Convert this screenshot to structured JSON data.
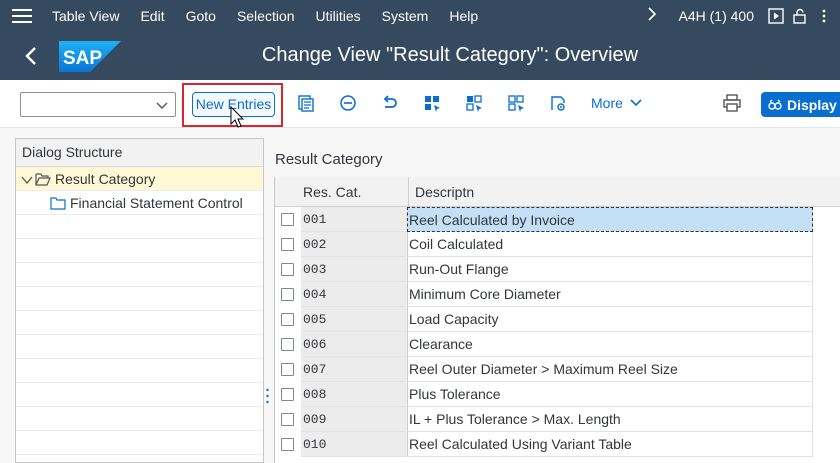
{
  "menubar": {
    "items": [
      "Table View",
      "Edit",
      "Goto",
      "Selection",
      "Utilities",
      "System",
      "Help"
    ],
    "system_info": "A4H (1) 400"
  },
  "titlebar": {
    "logo_text": "SAP",
    "title": "Change View \"Result Category\": Overview"
  },
  "toolbar": {
    "combo_value": "",
    "new_entries_label": "New Entries",
    "more_label": "More",
    "display_label": "Display",
    "icons": [
      "copy-as-icon",
      "delete-icon",
      "undo-icon",
      "select-all-icon",
      "select-block-icon",
      "deselect-all-icon",
      "configuration-icon",
      "print-icon",
      "display-icon"
    ]
  },
  "dialog_structure": {
    "header": "Dialog Structure",
    "items": [
      {
        "label": "Result Category",
        "selected": true,
        "expanded": true
      },
      {
        "label": "Financial Statement Control",
        "selected": false
      }
    ]
  },
  "table": {
    "title": "Result Category",
    "columns": [
      "Res. Cat.",
      "Descriptn"
    ],
    "rows": [
      {
        "key": "001",
        "desc": "Reel Calculated by Invoice"
      },
      {
        "key": "002",
        "desc": "Coil Calculated"
      },
      {
        "key": "003",
        "desc": "Run-Out Flange"
      },
      {
        "key": "004",
        "desc": "Minimum Core Diameter"
      },
      {
        "key": "005",
        "desc": "Load Capacity"
      },
      {
        "key": "006",
        "desc": "Clearance"
      },
      {
        "key": "007",
        "desc": "Reel Outer Diameter > Maximum Reel Size"
      },
      {
        "key": "008",
        "desc": "Plus Tolerance"
      },
      {
        "key": "009",
        "desc": "IL + Plus Tolerance > Max. Length"
      },
      {
        "key": "010",
        "desc": "Reel Calculated Using Variant Table"
      }
    ]
  },
  "colors": {
    "shell": "#354a5f",
    "accent": "#0a6ed1",
    "highlight_box": "#d7262e",
    "selected_row": "#c4e0f6"
  }
}
